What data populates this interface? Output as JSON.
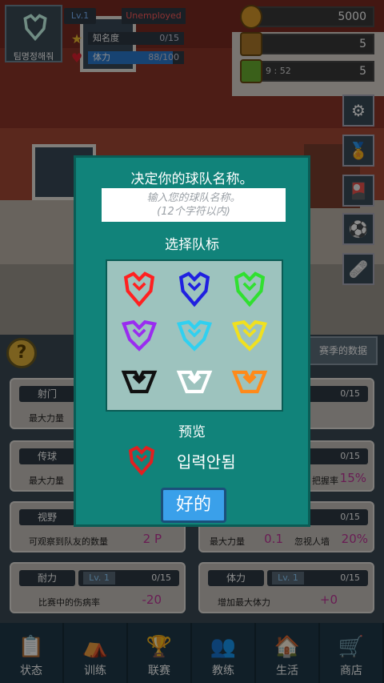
{
  "hud": {
    "team_name": "팀명정해줘",
    "level": "Lv.1",
    "status": "Unemployed",
    "fame_label": "知名度",
    "fame_count": "0/15",
    "stamina_label": "体力",
    "stamina_value": "88/100",
    "stamina_fraction": 0.88,
    "gold": "5000",
    "token": "5",
    "energy_time": "9 : 52",
    "energy": "5"
  },
  "side_buttons": [
    "settings-icon",
    "medal-icon",
    "card-icon",
    "ball-icon",
    "tape-icon"
  ],
  "panel": {
    "help": "?",
    "season_button": "赛季的数据",
    "cards": [
      {
        "title": "射门",
        "level": "",
        "count": "",
        "desc": "最大力量",
        "value": ""
      },
      {
        "title": "",
        "level": "",
        "count": "0/15",
        "desc": "",
        "value": ""
      },
      {
        "title": "传球",
        "level": "",
        "count": "",
        "desc": "最大力量",
        "value": ""
      },
      {
        "title": "",
        "level": "",
        "count": "0/15",
        "desc": "把握率",
        "value": "15%"
      },
      {
        "title": "视野",
        "level": "",
        "count": "",
        "desc": "可观察到队友的数量",
        "value": "2 P"
      },
      {
        "title": "",
        "level": "",
        "count": "0/15",
        "desc": "最大力量",
        "value": "0.1"
      },
      {
        "title": "耐力",
        "level": "Lv. 1",
        "count": "0/15",
        "desc": "比赛中的伤病率",
        "value": "-20"
      },
      {
        "title": "体力",
        "level": "Lv. 1",
        "count": "0/15",
        "desc": "增加最大体力",
        "value": "+0"
      }
    ],
    "extra_label": "忽视人墙",
    "extra_value": "20%"
  },
  "nav": [
    {
      "label": "状态",
      "icon": "clipboard-icon",
      "glyph": "📋"
    },
    {
      "label": "训练",
      "icon": "cones-icon",
      "glyph": "⛺"
    },
    {
      "label": "联赛",
      "icon": "trophy-icon",
      "glyph": "🏆"
    },
    {
      "label": "教练",
      "icon": "coach-icon",
      "glyph": "👥"
    },
    {
      "label": "生活",
      "icon": "home-icon",
      "glyph": "🏠"
    },
    {
      "label": "商店",
      "icon": "cart-icon",
      "glyph": "🛒"
    }
  ],
  "modal": {
    "title": "决定你的球队名称。",
    "input_placeholder_line1": "输入您的球队名称。",
    "input_placeholder_line2": "(12个字符以内)",
    "emblem_section": "选择队标",
    "emblem_colors": [
      "#ff2020",
      "#2020e0",
      "#30e030",
      "#9a2cf0",
      "#30d0f0",
      "#f0e020",
      "#111111",
      "#ffffff",
      "#ff8a1a"
    ],
    "preview_label": "预览",
    "preview_color": "#e02020",
    "preview_name": "입력안됨",
    "ok_button": "好的"
  }
}
